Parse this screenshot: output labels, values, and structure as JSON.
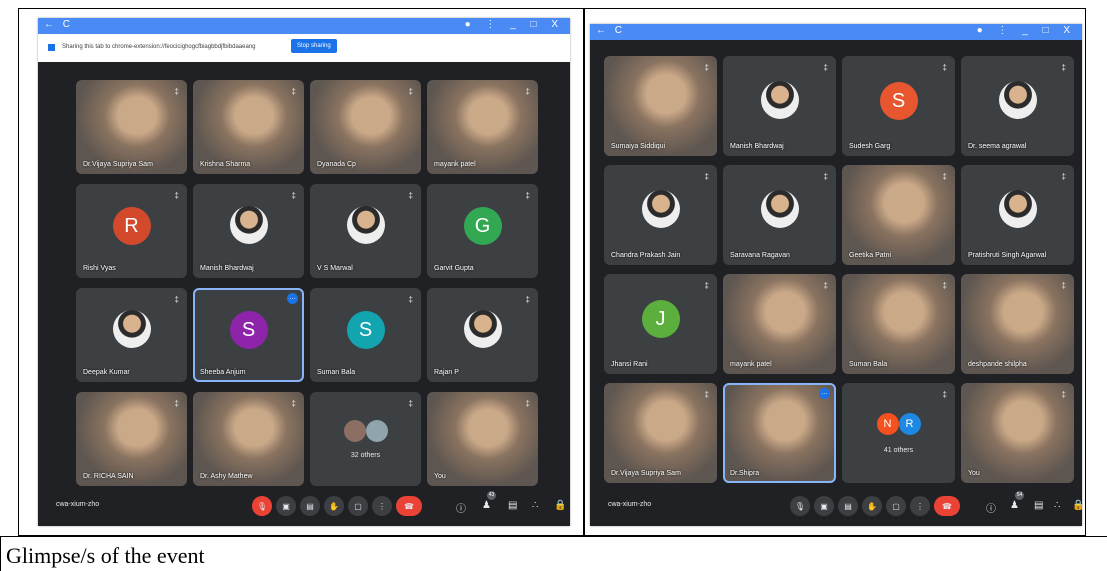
{
  "caption": "Glimpse/s of the event",
  "left_window": {
    "titlebar": {
      "nav": "← C",
      "controls": "● ⋮ _ □ X"
    },
    "share_bar": {
      "text": "Sharing this tab to chrome-extension://feocicighogcfbiagbbdjfbibdaaeang",
      "stop_label": "Stop sharing"
    },
    "tiles": [
      {
        "name": "Dr.Vijaya Supriya Sam",
        "kind": "video"
      },
      {
        "name": "Krishna Sharma",
        "kind": "video"
      },
      {
        "name": "Dyanada Cp",
        "kind": "video"
      },
      {
        "name": "mayank patel",
        "kind": "video"
      },
      {
        "name": "Rishi Vyas",
        "kind": "letter",
        "letter": "R",
        "color": "#d24a2b"
      },
      {
        "name": "Manish Bhardwaj",
        "kind": "photo"
      },
      {
        "name": "V S Marwal",
        "kind": "photo"
      },
      {
        "name": "Garvit Gupta",
        "kind": "letter",
        "letter": "G",
        "color": "#33a852"
      },
      {
        "name": "Deepak Kumar",
        "kind": "photo"
      },
      {
        "name": "Sheeba Anjum",
        "kind": "letter",
        "letter": "S",
        "color": "#8e24aa",
        "highlight": true
      },
      {
        "name": "Suman Bala",
        "kind": "letter",
        "letter": "S",
        "color": "#12a4af"
      },
      {
        "name": "Rajan P",
        "kind": "photo"
      },
      {
        "name": "Dr. RICHA SAIN",
        "kind": "video"
      },
      {
        "name": "Dr. Ashy Mathew",
        "kind": "video"
      },
      {
        "name": "32 others",
        "kind": "others"
      },
      {
        "name": "You",
        "kind": "video"
      }
    ],
    "bottom": {
      "meeting_code": "cwa-xium-zho",
      "people_count": "43"
    }
  },
  "right_window": {
    "titlebar": {
      "nav": "← C",
      "controls": "● ⋮ _ □ X"
    },
    "tiles": [
      {
        "name": "Sumaiya Siddiqui",
        "kind": "video"
      },
      {
        "name": "Manish Bhardwaj",
        "kind": "photo"
      },
      {
        "name": "Sudesh Garg",
        "kind": "letter",
        "letter": "S",
        "color": "#e8562f"
      },
      {
        "name": "Dr. seema agrawal",
        "kind": "photo"
      },
      {
        "name": "Chandra Prakash Jain",
        "kind": "photo"
      },
      {
        "name": "Saravana Ragavan",
        "kind": "photo"
      },
      {
        "name": "Geetika Patni",
        "kind": "video"
      },
      {
        "name": "Pratishruti Singh Agarwal",
        "kind": "photo"
      },
      {
        "name": "Jhansi Rani",
        "kind": "letter",
        "letter": "J",
        "color": "#5caf3c"
      },
      {
        "name": "mayank patel",
        "kind": "video"
      },
      {
        "name": "Suman Bala",
        "kind": "video"
      },
      {
        "name": "deshpande shilpha",
        "kind": "video"
      },
      {
        "name": "Dr.Vijaya Supriya Sam",
        "kind": "video"
      },
      {
        "name": "Dr.Shipra",
        "kind": "video",
        "highlight": true
      },
      {
        "name": "41 others",
        "kind": "others2"
      },
      {
        "name": "You",
        "kind": "video"
      }
    ],
    "bottom": {
      "meeting_code": "cwa-xium-zho",
      "people_count": "54"
    }
  }
}
